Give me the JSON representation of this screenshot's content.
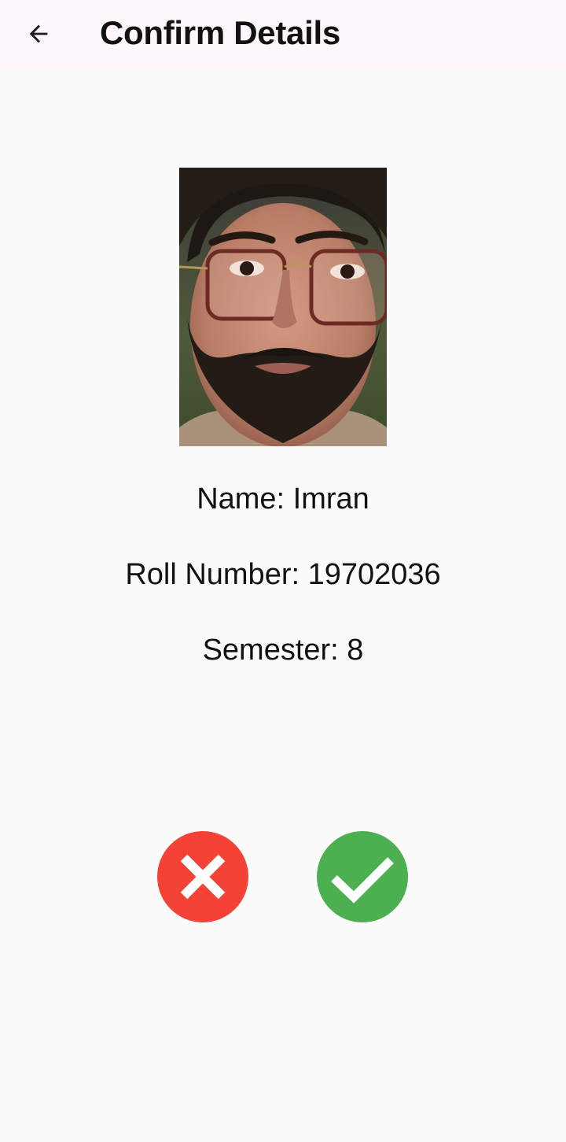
{
  "header": {
    "title": "Confirm Details",
    "back_icon": "arrow-left-icon"
  },
  "profile": {
    "photo_alt": "",
    "name_line": "Name: Imran",
    "roll_line": "Roll Number: 19702036",
    "semester_line": "Semester: 8"
  },
  "actions": {
    "reject_icon": "close-icon",
    "reject_color": "#f44336",
    "confirm_icon": "check-icon",
    "confirm_color": "#4caf50"
  },
  "colors": {
    "app_bar_bg": "#fdf6fb",
    "page_bg": "#fcfbfc",
    "text": "#111111"
  }
}
